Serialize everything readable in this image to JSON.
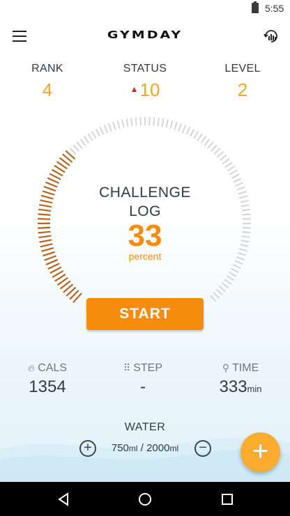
{
  "status_bar": {
    "time": "5:55",
    "battery_icon": "battery-icon"
  },
  "app_bar": {
    "title": "GYMDAY",
    "menu_icon": "hamburger-menu-icon",
    "sync_icon": "sync-chart-icon"
  },
  "stats": {
    "rank": {
      "label": "RANK",
      "value": "4"
    },
    "status": {
      "label": "STATUS",
      "value": "10",
      "trend": "up"
    },
    "level": {
      "label": "LEVEL",
      "value": "2"
    }
  },
  "challenge": {
    "line1": "CHALLENGE",
    "line2": "LOG",
    "percent": 33,
    "percent_value": "33",
    "percent_label": "percent",
    "start_label": "START"
  },
  "metrics": {
    "cals": {
      "label": "CALS",
      "value": "1354",
      "icon": "flame-icon"
    },
    "step": {
      "label": "STEP",
      "value": "-",
      "icon": "footprints-icon"
    },
    "time": {
      "label": "TIME",
      "value": "333",
      "unit": "min",
      "icon": "exercise-person-icon"
    }
  },
  "water": {
    "label": "WATER",
    "current": "750",
    "goal": "2000",
    "unit": "ml",
    "separator": "/"
  },
  "colors": {
    "accent": "#f58c0c",
    "stat_value": "#f5a623",
    "fab": "#fbab2d",
    "dial_progress": "#b5651d",
    "dial_track": "#cfd3d6"
  }
}
